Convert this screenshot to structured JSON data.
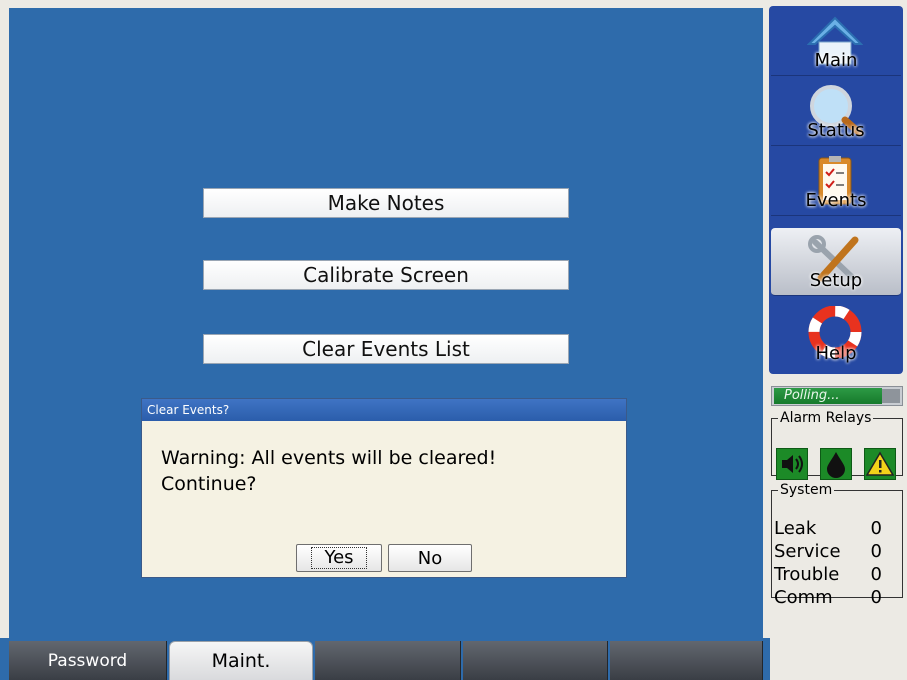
{
  "main": {
    "buttons": [
      "Make Notes",
      "Calibrate Screen",
      "Clear Events List"
    ]
  },
  "dialog": {
    "title": "Clear Events?",
    "message_line1": "Warning: All events will be cleared!",
    "message_line2": "Continue?",
    "yes_label": "Yes",
    "no_label": "No"
  },
  "nav": {
    "items": [
      {
        "label": "Main",
        "icon": "home-icon",
        "active": false
      },
      {
        "label": "Status",
        "icon": "magnifier-icon",
        "active": false
      },
      {
        "label": "Events",
        "icon": "clipboard-icon",
        "active": false
      },
      {
        "label": "Setup",
        "icon": "tools-icon",
        "active": true
      },
      {
        "label": "Help",
        "icon": "lifebuoy-icon",
        "active": false
      }
    ]
  },
  "polling": {
    "text": "Polling..."
  },
  "alarm_relays": {
    "title": "Alarm Relays",
    "relays": [
      {
        "icon": "speaker-icon"
      },
      {
        "icon": "drop-icon"
      },
      {
        "icon": "warning-icon"
      }
    ]
  },
  "system": {
    "title": "System",
    "rows": [
      {
        "label": "Leak",
        "value": "0"
      },
      {
        "label": "Service",
        "value": "0"
      },
      {
        "label": "Trouble",
        "value": "0"
      },
      {
        "label": "Comm",
        "value": "0"
      }
    ]
  },
  "bottom_tabs": [
    {
      "label": "Password",
      "active": false
    },
    {
      "label": "Maint.",
      "active": true
    },
    {
      "label": "",
      "active": false
    },
    {
      "label": "",
      "active": false
    },
    {
      "label": "",
      "active": false
    }
  ],
  "colors": {
    "work_area": "#2e6bab",
    "nav_bg": "#2649a3",
    "polling_green": "#1c8a27"
  }
}
